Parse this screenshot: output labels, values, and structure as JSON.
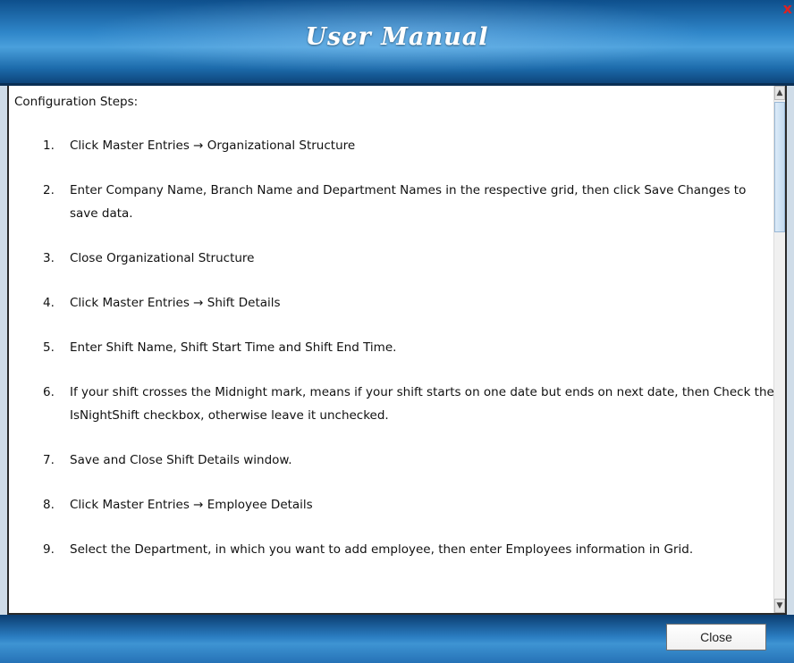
{
  "window": {
    "title": "User Manual",
    "close_glyph": "x"
  },
  "content": {
    "heading": "Configuration Steps:",
    "steps": [
      {
        "num": "1.",
        "text": "Click Master Entries → Organizational Structure"
      },
      {
        "num": "2.",
        "text": "Enter Company Name, Branch Name and Department Names in the respective grid, then click Save Changes to save data."
      },
      {
        "num": "3.",
        "text": "Close Organizational Structure"
      },
      {
        "num": "4.",
        "text": "Click Master Entries → Shift Details"
      },
      {
        "num": "5.",
        "text": "Enter Shift Name, Shift Start Time and Shift End Time."
      },
      {
        "num": "6.",
        "text": "If your shift crosses the Midnight mark, means if your shift starts on one date but ends on next date, then Check the IsNightShift checkbox, otherwise leave it unchecked."
      },
      {
        "num": "7.",
        "text": "Save and Close Shift Details window."
      },
      {
        "num": "8.",
        "text": "Click Master Entries → Employee Details"
      },
      {
        "num": "9.",
        "text": "Select the Department, in which you want to add employee, then enter Employees information in Grid."
      }
    ]
  },
  "footer": {
    "close_label": "Close"
  },
  "icons": {
    "close": "close-icon",
    "scroll_up": "chevron-up-icon",
    "scroll_down": "chevron-down-icon"
  },
  "colors": {
    "titlebar": "#2f86c9",
    "close_x": "#d22222"
  }
}
